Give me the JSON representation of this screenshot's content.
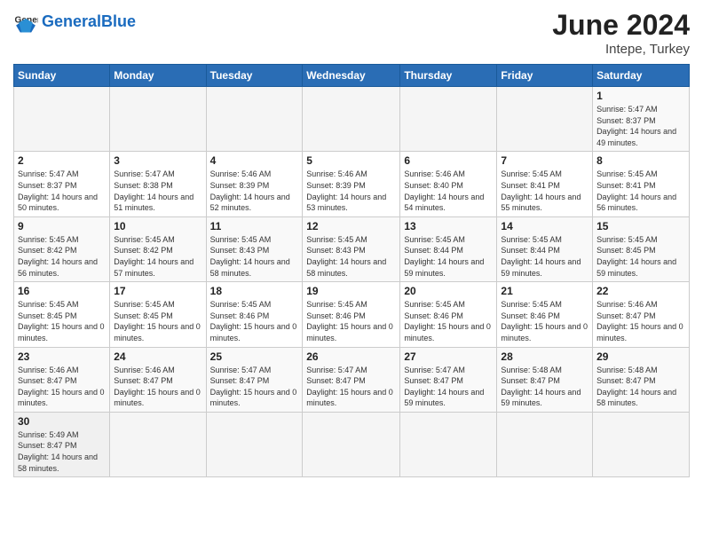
{
  "header": {
    "logo_general": "General",
    "logo_blue": "Blue",
    "month_year": "June 2024",
    "location": "Intepe, Turkey"
  },
  "weekdays": [
    "Sunday",
    "Monday",
    "Tuesday",
    "Wednesday",
    "Thursday",
    "Friday",
    "Saturday"
  ],
  "weeks": [
    [
      {
        "day": "",
        "info": ""
      },
      {
        "day": "",
        "info": ""
      },
      {
        "day": "",
        "info": ""
      },
      {
        "day": "",
        "info": ""
      },
      {
        "day": "",
        "info": ""
      },
      {
        "day": "",
        "info": ""
      },
      {
        "day": "1",
        "info": "Sunrise: 5:47 AM\nSunset: 8:37 PM\nDaylight: 14 hours and 49 minutes."
      }
    ],
    [
      {
        "day": "2",
        "info": "Sunrise: 5:47 AM\nSunset: 8:37 PM\nDaylight: 14 hours and 50 minutes."
      },
      {
        "day": "3",
        "info": "Sunrise: 5:47 AM\nSunset: 8:38 PM\nDaylight: 14 hours and 51 minutes."
      },
      {
        "day": "4",
        "info": "Sunrise: 5:46 AM\nSunset: 8:39 PM\nDaylight: 14 hours and 52 minutes."
      },
      {
        "day": "5",
        "info": "Sunrise: 5:46 AM\nSunset: 8:39 PM\nDaylight: 14 hours and 53 minutes."
      },
      {
        "day": "6",
        "info": "Sunrise: 5:46 AM\nSunset: 8:40 PM\nDaylight: 14 hours and 54 minutes."
      },
      {
        "day": "7",
        "info": "Sunrise: 5:45 AM\nSunset: 8:41 PM\nDaylight: 14 hours and 55 minutes."
      },
      {
        "day": "8",
        "info": "Sunrise: 5:45 AM\nSunset: 8:41 PM\nDaylight: 14 hours and 56 minutes."
      }
    ],
    [
      {
        "day": "9",
        "info": "Sunrise: 5:45 AM\nSunset: 8:42 PM\nDaylight: 14 hours and 56 minutes."
      },
      {
        "day": "10",
        "info": "Sunrise: 5:45 AM\nSunset: 8:42 PM\nDaylight: 14 hours and 57 minutes."
      },
      {
        "day": "11",
        "info": "Sunrise: 5:45 AM\nSunset: 8:43 PM\nDaylight: 14 hours and 58 minutes."
      },
      {
        "day": "12",
        "info": "Sunrise: 5:45 AM\nSunset: 8:43 PM\nDaylight: 14 hours and 58 minutes."
      },
      {
        "day": "13",
        "info": "Sunrise: 5:45 AM\nSunset: 8:44 PM\nDaylight: 14 hours and 59 minutes."
      },
      {
        "day": "14",
        "info": "Sunrise: 5:45 AM\nSunset: 8:44 PM\nDaylight: 14 hours and 59 minutes."
      },
      {
        "day": "15",
        "info": "Sunrise: 5:45 AM\nSunset: 8:45 PM\nDaylight: 14 hours and 59 minutes."
      }
    ],
    [
      {
        "day": "16",
        "info": "Sunrise: 5:45 AM\nSunset: 8:45 PM\nDaylight: 15 hours and 0 minutes."
      },
      {
        "day": "17",
        "info": "Sunrise: 5:45 AM\nSunset: 8:45 PM\nDaylight: 15 hours and 0 minutes."
      },
      {
        "day": "18",
        "info": "Sunrise: 5:45 AM\nSunset: 8:46 PM\nDaylight: 15 hours and 0 minutes."
      },
      {
        "day": "19",
        "info": "Sunrise: 5:45 AM\nSunset: 8:46 PM\nDaylight: 15 hours and 0 minutes."
      },
      {
        "day": "20",
        "info": "Sunrise: 5:45 AM\nSunset: 8:46 PM\nDaylight: 15 hours and 0 minutes."
      },
      {
        "day": "21",
        "info": "Sunrise: 5:45 AM\nSunset: 8:46 PM\nDaylight: 15 hours and 0 minutes."
      },
      {
        "day": "22",
        "info": "Sunrise: 5:46 AM\nSunset: 8:47 PM\nDaylight: 15 hours and 0 minutes."
      }
    ],
    [
      {
        "day": "23",
        "info": "Sunrise: 5:46 AM\nSunset: 8:47 PM\nDaylight: 15 hours and 0 minutes."
      },
      {
        "day": "24",
        "info": "Sunrise: 5:46 AM\nSunset: 8:47 PM\nDaylight: 15 hours and 0 minutes."
      },
      {
        "day": "25",
        "info": "Sunrise: 5:47 AM\nSunset: 8:47 PM\nDaylight: 15 hours and 0 minutes."
      },
      {
        "day": "26",
        "info": "Sunrise: 5:47 AM\nSunset: 8:47 PM\nDaylight: 15 hours and 0 minutes."
      },
      {
        "day": "27",
        "info": "Sunrise: 5:47 AM\nSunset: 8:47 PM\nDaylight: 14 hours and 59 minutes."
      },
      {
        "day": "28",
        "info": "Sunrise: 5:48 AM\nSunset: 8:47 PM\nDaylight: 14 hours and 59 minutes."
      },
      {
        "day": "29",
        "info": "Sunrise: 5:48 AM\nSunset: 8:47 PM\nDaylight: 14 hours and 58 minutes."
      }
    ],
    [
      {
        "day": "30",
        "info": "Sunrise: 5:49 AM\nSunset: 8:47 PM\nDaylight: 14 hours and 58 minutes."
      },
      {
        "day": "",
        "info": ""
      },
      {
        "day": "",
        "info": ""
      },
      {
        "day": "",
        "info": ""
      },
      {
        "day": "",
        "info": ""
      },
      {
        "day": "",
        "info": ""
      },
      {
        "day": "",
        "info": ""
      }
    ]
  ]
}
